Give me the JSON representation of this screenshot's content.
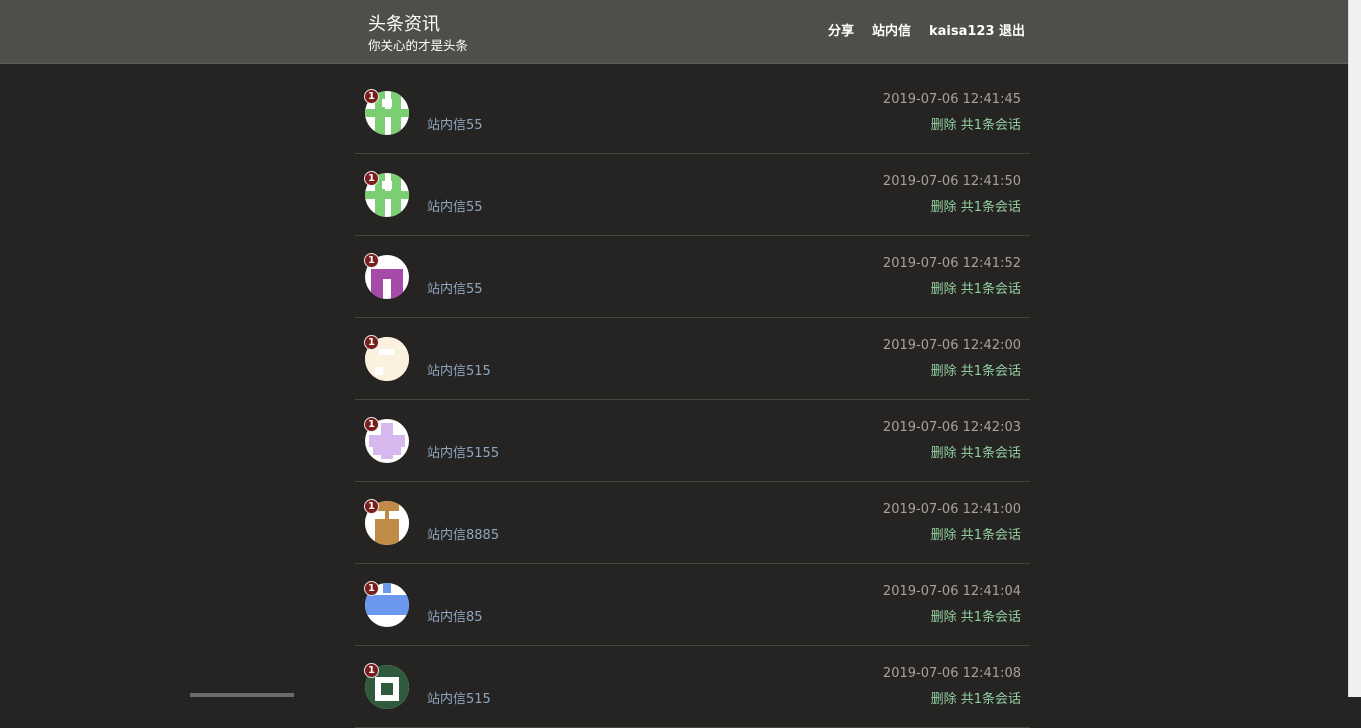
{
  "header": {
    "title": "头条资讯",
    "subtitle": "你关心的才是头条",
    "nav": [
      {
        "label": "分享"
      },
      {
        "label": "站内信"
      },
      {
        "label": "kaisa123"
      },
      {
        "label": "退出"
      }
    ]
  },
  "conversations": [
    {
      "badge": "1",
      "message": "站内信55",
      "time": "2019-07-06 12:41:45",
      "delete": "删除",
      "count_text": "共1条会话",
      "avatar_color": "#7bcf72",
      "avatar_pattern": "pillars"
    },
    {
      "badge": "1",
      "message": "站内信55",
      "time": "2019-07-06 12:41:50",
      "delete": "删除",
      "count_text": "共1条会话",
      "avatar_color": "#7bcf72",
      "avatar_pattern": "pillars"
    },
    {
      "badge": "1",
      "message": "站内信55",
      "time": "2019-07-06 12:41:52",
      "delete": "删除",
      "count_text": "共1条会话",
      "avatar_color": "#a54aa9",
      "avatar_pattern": "legs"
    },
    {
      "badge": "1",
      "message": "站内信515",
      "time": "2019-07-06 12:42:00",
      "delete": "删除",
      "count_text": "共1条会话",
      "avatar_color": "#fbf1de",
      "avatar_pattern": "block"
    },
    {
      "badge": "1",
      "message": "站内信5155",
      "time": "2019-07-06 12:42:03",
      "delete": "删除",
      "count_text": "共1条会话",
      "avatar_color": "#d6b8ee",
      "avatar_pattern": "cross"
    },
    {
      "badge": "1",
      "message": "站内信8885",
      "time": "2019-07-06 12:41:00",
      "delete": "删除",
      "count_text": "共1条会话",
      "avatar_color": "#c08a47",
      "avatar_pattern": "bottom"
    },
    {
      "badge": "1",
      "message": "站内信85",
      "time": "2019-07-06 12:41:04",
      "delete": "删除",
      "count_text": "共1条会话",
      "avatar_color": "#6b98ee",
      "avatar_pattern": "band"
    },
    {
      "badge": "1",
      "message": "站内信515",
      "time": "2019-07-06 12:41:08",
      "delete": "删除",
      "count_text": "共1条会话",
      "avatar_color": "#2f5b3c",
      "avatar_pattern": "frame"
    }
  ]
}
